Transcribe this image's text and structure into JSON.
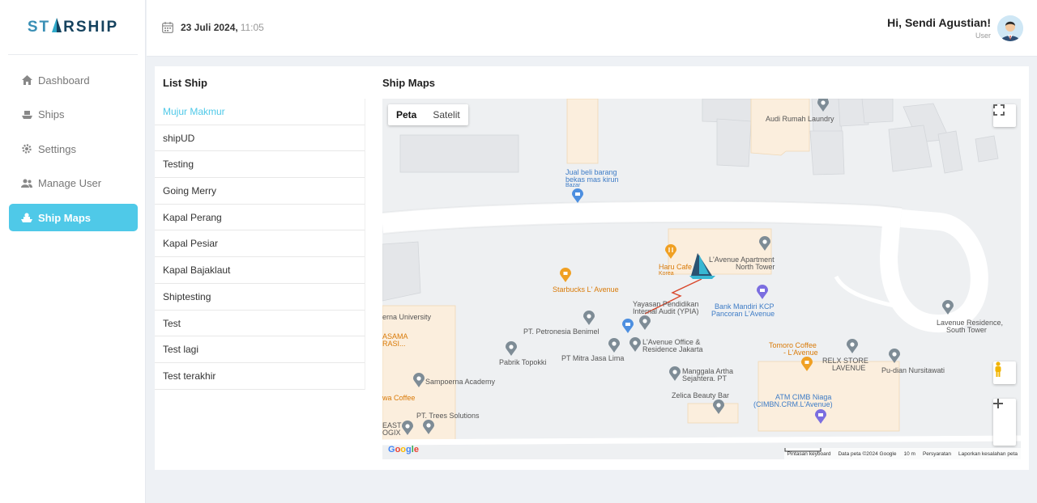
{
  "brand": {
    "part1": "ST",
    "part2": "RSHIP"
  },
  "sidebar": {
    "items": [
      {
        "label": "Dashboard",
        "icon": "home-icon"
      },
      {
        "label": "Ships",
        "icon": "ship-icon"
      },
      {
        "label": "Settings",
        "icon": "gear-icon"
      },
      {
        "label": "Manage User",
        "icon": "users-icon"
      },
      {
        "label": "Ship Maps",
        "icon": "map-ship-icon",
        "active": true
      }
    ]
  },
  "header": {
    "date": "23 Juli 2024,",
    "time": "11:05",
    "greeting": "Hi, Sendi Agustian!",
    "role": "User"
  },
  "list": {
    "title": "List Ship",
    "ships": [
      "Mujur Makmur",
      "shipUD",
      "Testing",
      "Going Merry",
      "Kapal Perang",
      "Kapal Pesiar",
      "Kapal Bajaklaut",
      "Shiptesting",
      "Test",
      "Test lagi",
      "Test terakhir"
    ]
  },
  "map": {
    "title": "Ship Maps",
    "toggle_map": "Peta",
    "toggle_sat": "Satelit",
    "google": "Google",
    "footer": [
      "Pintasan keyboard",
      "Data peta ©2024 Google",
      "10 m",
      "Persyaratan",
      "Laporkan kesalahan peta"
    ],
    "places": {
      "audi": "Audi Rumah Laundry",
      "jual1": "Jual beli barang",
      "jual2": "bekas mas kirun",
      "bazar": "Bazar",
      "haru": "Haru Cafe",
      "korea": "Korea",
      "lave1": "L'Avenue Apartment",
      "lave2": "North Tower",
      "starbucks": "Starbucks L' Avenue",
      "yayasan1": "Yayasan Pendidikan",
      "yayasan2": "Internal Audit (YPIA)",
      "mandiri1": "Bank Mandiri KCP",
      "mandiri2": "Pancoran L'Avenue",
      "univ": "erna University",
      "petro": "PT. Petronesia Benimel",
      "sasama1": "ASAMA",
      "sasama2": "RASI...",
      "office1": "L'Avenue Office &",
      "office2": "Residence Jakarta",
      "mitra": "PT Mitra Jasa Lima",
      "topokki": "Pabrik Topokki",
      "tomoro1": "Tomoro Coffee",
      "tomoro2": "- L'Avenue",
      "relx1": "RELX STORE",
      "relx2": "LAVENUE",
      "nursi": "Pu-dian Nursitawati",
      "lavres1": "Lavenue Residence,",
      "lavres2": "South Tower",
      "manggala1": "Manggala Artha",
      "manggala2": "Sejahtera. PT",
      "sampoerna": "Sampoerna Academy",
      "zelica": "Zelica Beauty Bar",
      "atm1": "ATM CIMB Niaga",
      "atm2": "(CIMBN.CRM.L'Avenue)",
      "coffee": "wa Coffee",
      "trees": "PT. Trees Solutions",
      "east1": "EAST",
      "east2": "OGIX"
    }
  }
}
